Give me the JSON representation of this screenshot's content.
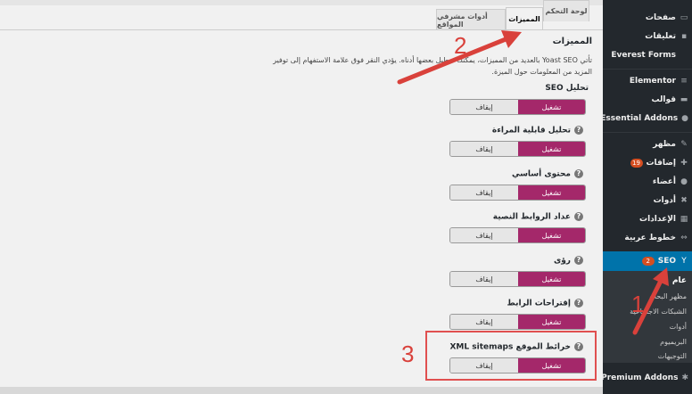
{
  "tabs": [
    {
      "label": "لوحة التحكم"
    },
    {
      "label": "المميزات"
    },
    {
      "label": "أدوات مشرفي المواقع"
    }
  ],
  "page": {
    "title": "المميزات",
    "description": "تأتي Yoast SEO بالعديد من المميزات، يمكنك تعطيل بعضها أدناه. يؤدي النقر فوق علامة الاستفهام إلى توفير المزيد من المعلومات حول الميزة."
  },
  "features": [
    {
      "label": "تحليل SEO",
      "on": "تشغيل",
      "off": "إيقاف",
      "help": false
    },
    {
      "label": "تحليل قابلية المراءة",
      "on": "تشغيل",
      "off": "إيقاف",
      "help": true
    },
    {
      "label": "محتوى أساسي",
      "on": "تشغيل",
      "off": "إيقاف",
      "help": true
    },
    {
      "label": "عداد الروابط النصية",
      "on": "تشغيل",
      "off": "إيقاف",
      "help": true
    },
    {
      "label": "رؤى",
      "on": "تشغيل",
      "off": "إيقاف",
      "help": true
    },
    {
      "label": "إقتراحات الرابط",
      "on": "تشغيل",
      "off": "إيقاف",
      "help": true
    },
    {
      "label": "خرائط الموقع XML sitemaps",
      "on": "تشغيل",
      "off": "إيقاف",
      "help": true
    }
  ],
  "help_glyph": "?",
  "annotations": [
    "1",
    "2",
    "3"
  ],
  "sidebar": {
    "items": [
      {
        "label": "صفحات",
        "icon": "page-icon"
      },
      {
        "label": "تعليقات",
        "icon": "comment-icon"
      },
      {
        "label": "Everest Forms",
        "icon": "form-icon"
      },
      {
        "label": "Elementor",
        "icon": "elementor-icon"
      },
      {
        "label": "قوالب",
        "icon": "template-icon"
      },
      {
        "label": "Essential Addons",
        "icon": "ea-icon"
      },
      {
        "label": "مظهر",
        "icon": "brush-icon"
      },
      {
        "label": "إضافات",
        "icon": "plugin-icon",
        "badge": "19"
      },
      {
        "label": "أعضاء",
        "icon": "user-icon"
      },
      {
        "label": "أدوات",
        "icon": "wrench-icon"
      },
      {
        "label": "الإعدادات",
        "icon": "settings-icon"
      },
      {
        "label": "خطوط عربية",
        "icon": "font-icon"
      },
      {
        "label": "SEO",
        "icon": "yoast-icon",
        "badge": "2"
      }
    ],
    "submenu": [
      "عام",
      "مظهر البحث",
      "الشبكات الاجتماعية",
      "أدوات",
      "البريميوم",
      "التوجيهات"
    ],
    "bottom": {
      "label": "Premium Addons",
      "icon": "star-icon"
    },
    "accent": "#0073aa"
  },
  "colors": {
    "toggle_on": "#a4286a",
    "badge": "#d54e21",
    "annotation": "#d9413b"
  }
}
